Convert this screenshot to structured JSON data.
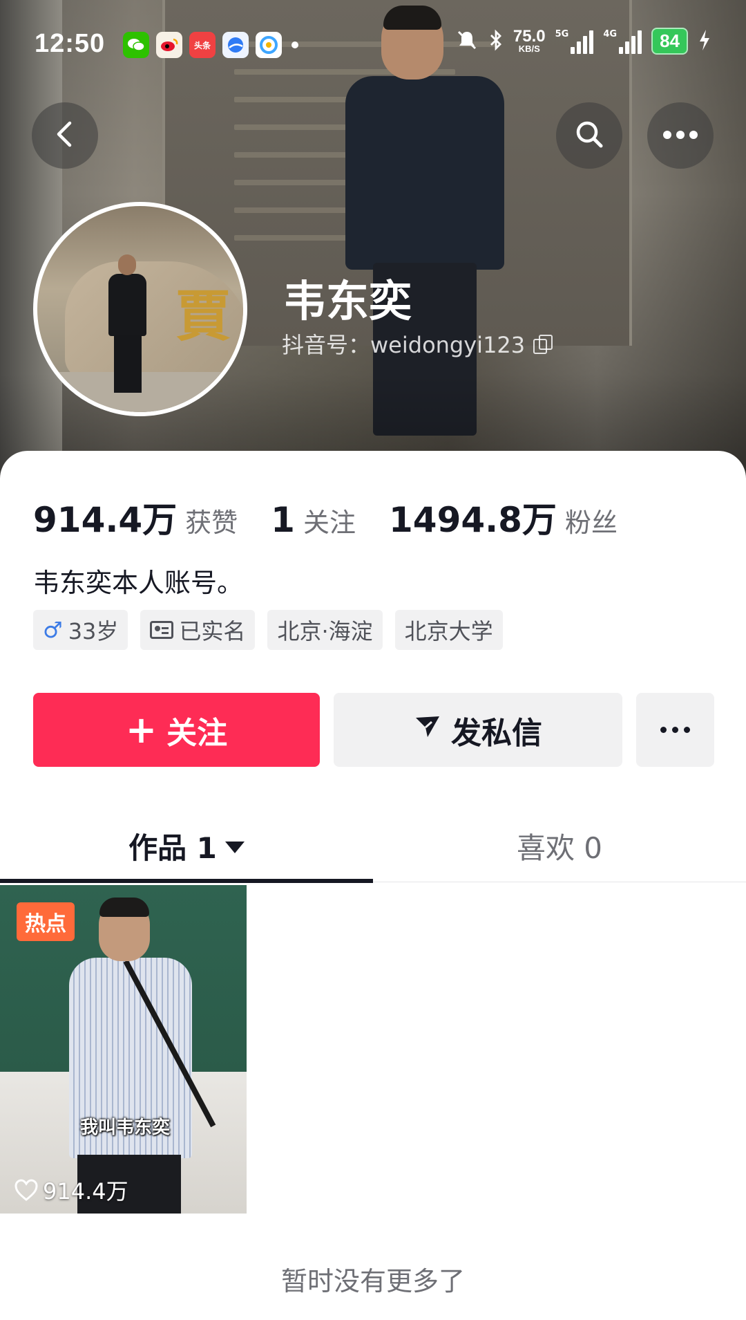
{
  "status_bar": {
    "time": "12:50",
    "app_icons": [
      {
        "name": "wechat-icon",
        "color": "#2dc100",
        "glyph": ""
      },
      {
        "name": "weibo-icon",
        "color": "#e6162d",
        "glyph": ""
      },
      {
        "name": "toutiao-icon",
        "color": "#f04142",
        "glyph": "头条"
      },
      {
        "name": "browser-icon",
        "color": "#2f7bf5",
        "glyph": ""
      },
      {
        "name": "qq-browser-icon",
        "color": "#3ea6ff",
        "glyph": ""
      }
    ],
    "net_speed": "75.0",
    "net_unit": "KB/S",
    "net_type_1": "5G",
    "net_type_2": "4G",
    "battery": "84"
  },
  "profile": {
    "name": "韦东奕",
    "douyin_id": "抖音号：weidongyi123",
    "bio": "韦东奕本人账号。",
    "avatar_char": "賈"
  },
  "stats": [
    {
      "value": "914.4万",
      "label": "获赞"
    },
    {
      "value": "1",
      "label": "关注"
    },
    {
      "value": "1494.8万",
      "label": "粉丝"
    }
  ],
  "tags": {
    "age": "33岁",
    "verified": "已实名",
    "location": "北京·海淀",
    "school": "北京大学"
  },
  "actions": {
    "follow": "关注",
    "message": "发私信"
  },
  "tabs": {
    "works": "作品 1",
    "likes": "喜欢 0"
  },
  "video": {
    "badge": "热点",
    "caption": "我叫韦东奕",
    "likes": "914.4万"
  },
  "footer": {
    "end_text": "暂时没有更多了"
  },
  "colors": {
    "accent": "#fe2c55",
    "badge": "#ff6a3a",
    "battery": "#35c75a"
  }
}
